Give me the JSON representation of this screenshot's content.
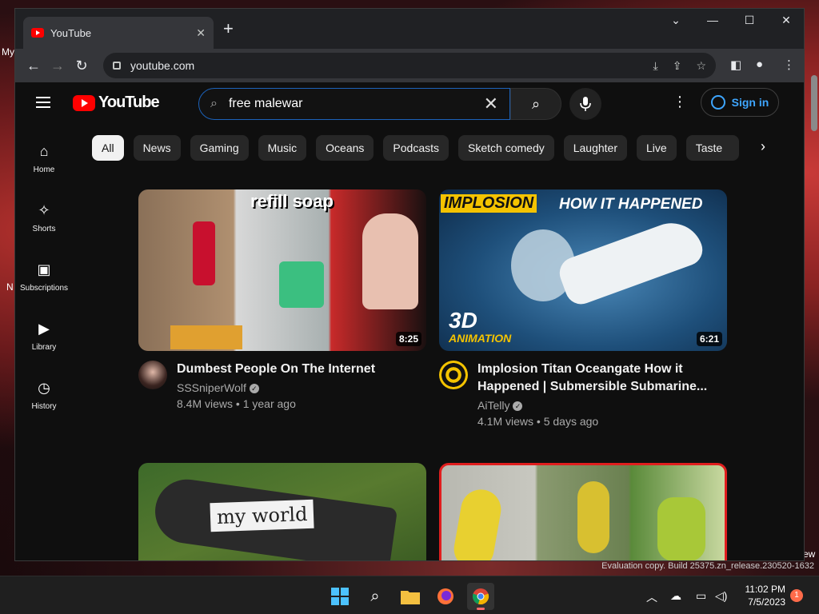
{
  "desktop": {
    "left_label_1": "My",
    "left_label_2": "N",
    "right_label": "ew",
    "watermark": "Evaluation copy. Build 25375.zn_release.230520-1632"
  },
  "browser": {
    "tab_title": "YouTube",
    "tab_close": "✕",
    "new_tab": "+",
    "url": "youtube.com",
    "controls": {
      "dropdown": "⌄",
      "minimize": "—",
      "maximize": "☐",
      "close": "✕"
    }
  },
  "youtube": {
    "logo_text": "YouTube",
    "search": {
      "value": "free malewar",
      "clear": "✕"
    },
    "sign_in": "Sign in",
    "guide": [
      {
        "label": "Home",
        "icon": "home-icon",
        "glyph": "⌂"
      },
      {
        "label": "Shorts",
        "icon": "shorts-icon",
        "glyph": "✧"
      },
      {
        "label": "Subscriptions",
        "icon": "subscriptions-icon",
        "glyph": "▣"
      },
      {
        "label": "Library",
        "icon": "library-icon",
        "glyph": "▶"
      },
      {
        "label": "History",
        "icon": "history-icon",
        "glyph": "◷"
      }
    ],
    "chips": [
      "All",
      "News",
      "Gaming",
      "Music",
      "Oceans",
      "Podcasts",
      "Sketch comedy",
      "Laughter",
      "Live",
      "Taste"
    ],
    "videos": [
      {
        "title": "Dumbest People On The Internet",
        "channel": "SSSniperWolf",
        "stats": "8.4M views • 1 year ago",
        "duration": "8:25",
        "thumb_text": "refill soap"
      },
      {
        "title": "Implosion Titan Oceangate How it Happened | Submersible Submarine...",
        "channel": "AiTelly",
        "stats": "4.1M views • 5 days ago",
        "duration": "6:21",
        "thumb_text_1": "IMPLOSION",
        "thumb_text_2": "HOW IT HAPPENED",
        "thumb_text_3": "3D",
        "thumb_text_4": "ANIMATION"
      },
      {
        "thumb_text": "my world"
      },
      {}
    ]
  },
  "taskbar": {
    "time": "11:02 PM",
    "date": "7/5/2023",
    "notifications": "1"
  },
  "colors": {
    "accent_blue": "#3ea6ff",
    "brand_red": "#ff0000",
    "bg": "#0f0f0f"
  }
}
